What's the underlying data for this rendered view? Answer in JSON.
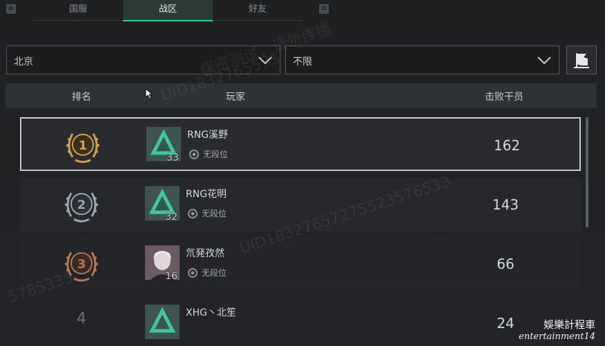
{
  "tabs": {
    "key_left": "A",
    "key_right": "D",
    "items": [
      {
        "label": "国服"
      },
      {
        "label": "战区"
      },
      {
        "label": "好友"
      }
    ],
    "active_index": 1
  },
  "filters": {
    "region": "北京",
    "sub_filter": "不限"
  },
  "table": {
    "headers": {
      "rank": "排名",
      "player": "玩家",
      "kills": "击败干员"
    },
    "rows": [
      {
        "rank": "1",
        "name": "RNG溪野",
        "level": "33",
        "tier": "无段位",
        "kills": "162",
        "medal_color": "#c9a44a"
      },
      {
        "rank": "2",
        "name": "RNG花明",
        "level": "32",
        "tier": "无段位",
        "kills": "143",
        "medal_color": "#9aa4b0"
      },
      {
        "rank": "3",
        "name": "氘発孜然",
        "level": "16",
        "tier": "无段位",
        "kills": "66",
        "medal_color": "#b57452"
      },
      {
        "rank": "4",
        "name": "XHG丶北笙",
        "level": "",
        "tier": "",
        "kills": "24",
        "medal_color": ""
      }
    ]
  },
  "watermarks": [
    "保密测试，请勿传播",
    "UID1832765535",
    "UID18327657275523576533",
    "5785335"
  ],
  "brand": {
    "line1": "娛樂計程車",
    "line2": "entertainment14"
  },
  "colors": {
    "accent": "#3fc7a0",
    "background": "#1f2123",
    "header": "#2f3235"
  }
}
